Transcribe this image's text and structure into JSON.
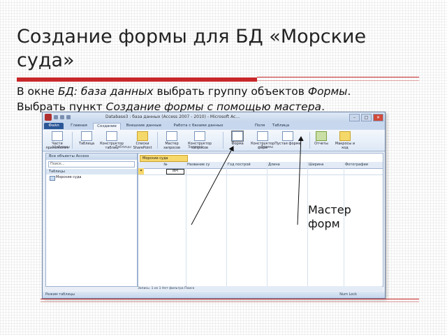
{
  "slide": {
    "title": "Создание формы для БД «Морские суда»",
    "line1_a": "В окне ",
    "line1_b": "БД: база данных",
    "line1_c": " выбрать группу объектов ",
    "line1_d": "Формы",
    "line1_e": ".",
    "line2_a": "Выбрать пункт  ",
    "line2_b": "Создание формы с помощью мастера",
    "line2_c": ".",
    "annotation": "Мастер форм"
  },
  "window": {
    "title": "Database3 : база данных (Access 2007 - 2010) - Microsoft Ac...",
    "tabs": [
      "Файл",
      "Главная",
      "Создание",
      "Внешние данные",
      "Работа с базами данных",
      "Поля",
      "Таблица"
    ],
    "ribbon": {
      "buttons": [
        "Части приложения",
        "Таблица",
        "Конструктор таблиц",
        "Списки SharePoint",
        "Мастер запросов",
        "Конструктор запросов",
        "Форма",
        "Конструктор форм",
        "Пустая форма",
        "Отчеты",
        "Макросы и код"
      ],
      "groups": [
        "Шаблоны",
        "Таблицы",
        "Запросы",
        "Формы"
      ]
    },
    "nav": {
      "header": "Все объекты Access",
      "search_placeholder": "Поиск...",
      "group": "Таблицы",
      "items": [
        "Морские суда"
      ]
    },
    "document": {
      "tab": "Морские суда",
      "columns": [
        "№",
        "Название су",
        "Год построй",
        "Длина",
        "Ширина",
        "Фотографии"
      ],
      "new_row_value": "(Nº)"
    },
    "record_bar": "Запись: 1 из 1   Нет фильтра   Поиск",
    "status": "Режим таблицы",
    "status_right": "Num Lock"
  },
  "colors": {
    "accent": "#c8282a",
    "ribbon": "#dde8f5",
    "file_tab": "#2b5797"
  }
}
